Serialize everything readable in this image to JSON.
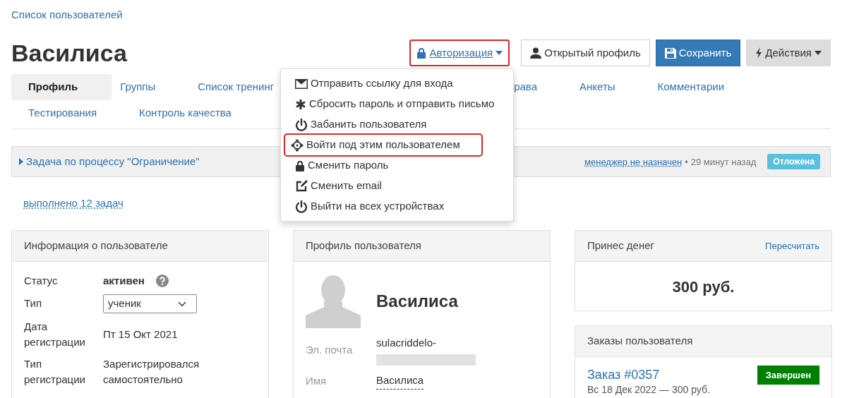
{
  "breadcrumb": "Список пользователей",
  "title": "Василиса",
  "toolbar": [
    {
      "kind": "link",
      "label": "Авторизация",
      "caret": true,
      "highlighted": true
    },
    {
      "kind": "default",
      "label": "Открытый профиль",
      "caret": false,
      "highlighted": false
    },
    {
      "kind": "primary",
      "label": "Сохранить",
      "caret": false,
      "highlighted": false
    },
    {
      "kind": "muted",
      "label": "Действия",
      "caret": true,
      "highlighted": false
    }
  ],
  "auth_menu": {
    "open": true,
    "items": [
      {
        "label": "Отправить ссылку для входа",
        "highlighted": false
      },
      {
        "label": "Сбросить пароль и отправить письмо",
        "highlighted": false
      },
      {
        "label": "Забанить пользователя",
        "highlighted": false
      },
      {
        "label": "Войти под этим пользователем",
        "highlighted": true
      },
      {
        "label": "Сменить пароль",
        "highlighted": false
      },
      {
        "label": "Сменить email",
        "highlighted": false
      },
      {
        "label": "Выйти на всех устройствах",
        "highlighted": false
      }
    ]
  },
  "tab_rows": [
    [
      {
        "label": "Профиль",
        "selected": true
      },
      {
        "label": "Группы",
        "selected": false
      },
      {
        "label": "Список тренинг",
        "selected": false
      },
      {
        "label": "рава",
        "selected": false
      },
      {
        "label": "Анкеты",
        "selected": false
      },
      {
        "label": "Комментарии",
        "selected": false
      }
    ],
    [
      {
        "label": "Тестирования",
        "selected": false
      },
      {
        "label": "Контроль качества",
        "selected": false
      }
    ]
  ],
  "task": {
    "title": "Задача по процессу \"Ограничение\"",
    "manager": "менеджер не назначен",
    "separator": "•",
    "time": "29 минут назад",
    "status": "Отложена"
  },
  "tasks_done": "выполнено 12 задач",
  "info_card": {
    "title": "Информация о пользователе",
    "rows": [
      {
        "kind": "status",
        "label": "Статус",
        "value": "активен"
      },
      {
        "kind": "select",
        "label": "Тип",
        "value": "ученик"
      },
      {
        "kind": "text",
        "label": "Дата регистрации",
        "value": "Пт 15 Окт 2021"
      },
      {
        "kind": "text",
        "label": "Тип регистрации",
        "value": "Зарегистрировался самостоятельно"
      }
    ]
  },
  "profile_card": {
    "title": "Профиль пользователя",
    "name": "Василиса",
    "fields": [
      {
        "kind": "email",
        "label": "Эл. почта",
        "value": "sulacriddelo-"
      },
      {
        "kind": "editable",
        "label": "Имя",
        "value": "Василиса"
      }
    ]
  },
  "money_card": {
    "title": "Принес денег",
    "action": "Пересчитать",
    "amount": "300 руб."
  },
  "orders_card": {
    "title": "Заказы пользователя",
    "orders": [
      {
        "number": "Заказ #0357",
        "status": "Завершен",
        "color": "#008000",
        "details": "Вс 18 Дек 2022 — 300 руб."
      }
    ]
  }
}
